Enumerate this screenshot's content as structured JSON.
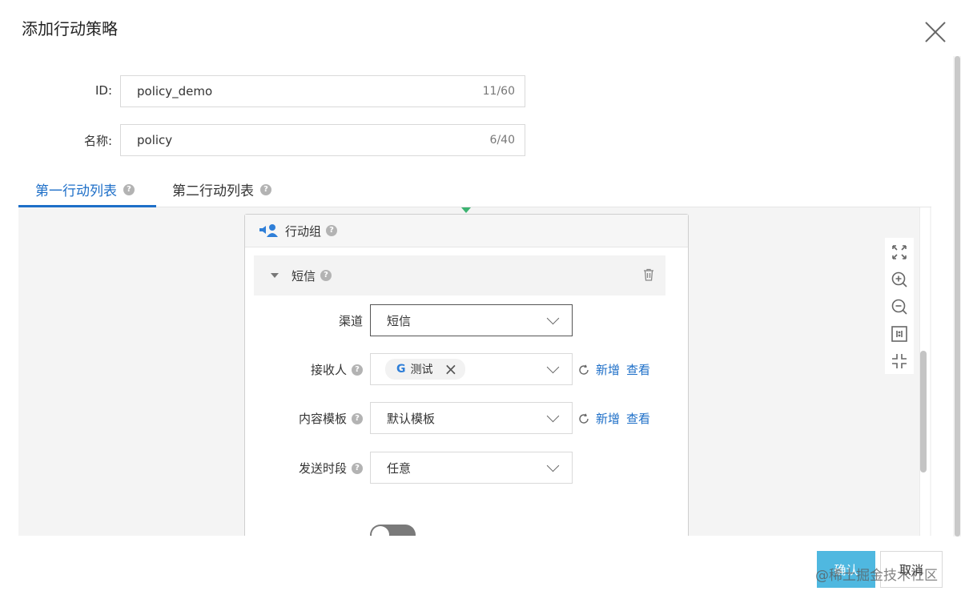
{
  "dialog": {
    "title": "添加行动策略"
  },
  "form": {
    "id": {
      "label": "ID:",
      "value": "policy_demo",
      "count": "11/60"
    },
    "name": {
      "label": "名称:",
      "value": "policy",
      "count": "6/40"
    }
  },
  "tabs": [
    {
      "label": "第一行动列表",
      "active": true
    },
    {
      "label": "第二行动列表",
      "active": false
    }
  ],
  "action_group": {
    "title": "行动组",
    "channel_section": {
      "title": "短信",
      "fields": {
        "channel": {
          "label": "渠道",
          "value": "短信"
        },
        "recipient": {
          "label": "接收人",
          "tag_icon": "G",
          "tag_text": "测试"
        },
        "template": {
          "label": "内容模板",
          "value": "默认模板"
        },
        "send_time": {
          "label": "发送时段",
          "value": "任意"
        }
      },
      "links": {
        "add": "新增",
        "view": "查看"
      }
    }
  },
  "footer": {
    "confirm": "确认",
    "cancel": "取消"
  },
  "watermark": "@稀土掘金技术社区",
  "colors": {
    "accent": "#1e6fc8",
    "confirm_button": "#4fb8e0",
    "connector": "#3cb371"
  }
}
